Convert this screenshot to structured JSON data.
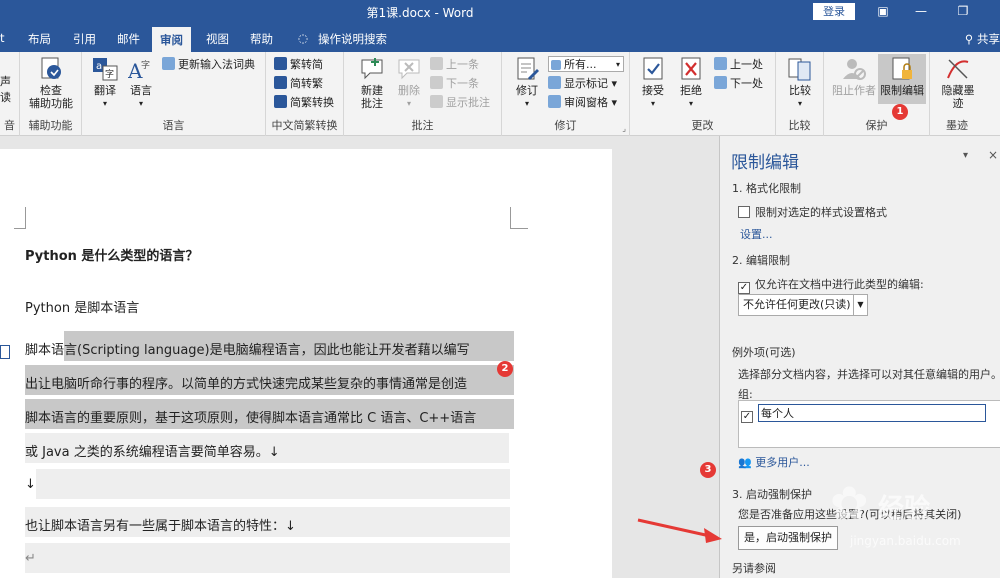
{
  "window": {
    "title": "第1课.docx - Word",
    "login": "登录"
  },
  "tabs": [
    "t",
    "布局",
    "引用",
    "邮件",
    "审阅",
    "视图",
    "帮助",
    "操作说明搜索"
  ],
  "active_tab": "审阅",
  "share": "共享",
  "ribbon": {
    "g0": {
      "btn1": "声",
      "btn2": "读",
      "label": "音"
    },
    "proofing": {
      "check": "检查",
      "check2": "辅助功能",
      "label": "辅助功能"
    },
    "language": {
      "translate": "翻译",
      "language": "语言",
      "update": "更新输入法词典",
      "label": "语言"
    },
    "chinese": {
      "to_trad": "繁转简",
      "to_simp": "简转繁",
      "convert": "简繁转换",
      "label": "中文简繁转换"
    },
    "comments": {
      "new": "新建",
      "new2": "批注",
      "delete": "删除",
      "prev": "上一条",
      "next": "下一条",
      "show": "显示批注",
      "label": "批注"
    },
    "tracking": {
      "track": "修订",
      "display": "所有...",
      "markup": "显示标记",
      "pane": "审阅窗格",
      "label": "修订"
    },
    "changes": {
      "accept": "接受",
      "reject": "拒绝",
      "prev": "上一处",
      "next": "下一处",
      "label": "更改"
    },
    "compare": {
      "compare": "比较",
      "label": "比较"
    },
    "protect": {
      "block": "阻止作者",
      "restrict": "限制编辑",
      "label": "保护"
    },
    "ink": {
      "hide": "隐藏墨",
      "hide2": "迹",
      "label": "墨迹"
    }
  },
  "document": {
    "heading": "Python 是什么类型的语言？",
    "subheading": "Python 是脚本语言",
    "para1": "脚本语言(Scripting language)是电脑编程语言，因此也能让开发者藉以编写",
    "para2": "出让电脑听命行事的程序。以简单的方式快速完成某些复杂的事情通常是创造",
    "para3": "脚本语言的重要原则，基于这项原则，使得脚本语言通常比 C 语言、C++语言",
    "para4": "或 Java 之类的系统编程语言要简单容易。↓",
    "para5": "↓",
    "para6": "也让脚本语言另有一些属于脚本语言的特性：↓",
    "para7": "↵"
  },
  "pane": {
    "title": "限制编辑",
    "sec1": "1. 格式化限制",
    "sec1_check": "限制对选定的样式设置格式",
    "settings": "设置...",
    "sec2": "2. 编辑限制",
    "sec2_check": "仅允许在文档中进行此类型的编辑:",
    "edit_type": "不允许任何更改(只读)",
    "exceptions": "例外项(可选)",
    "exceptions_desc": "选择部分文档内容，并选择可以对其任意编辑的用户。",
    "groups": "组:",
    "everyone": "每个人",
    "more_users": "更多用户...",
    "sec3": "3. 启动强制保护",
    "question": "您是否准备应用这些设置?(可以稍后将其关闭)",
    "start_btn": "是，启动强制保护",
    "see_also": "另请参阅"
  },
  "badges": [
    "1",
    "2",
    "3"
  ],
  "watermark": {
    "name": "经验",
    "url": "jingyan.baidu.com"
  },
  "colors": {
    "accent": "#2b579a",
    "badge": "#e53935",
    "arrow": "#e53935"
  }
}
